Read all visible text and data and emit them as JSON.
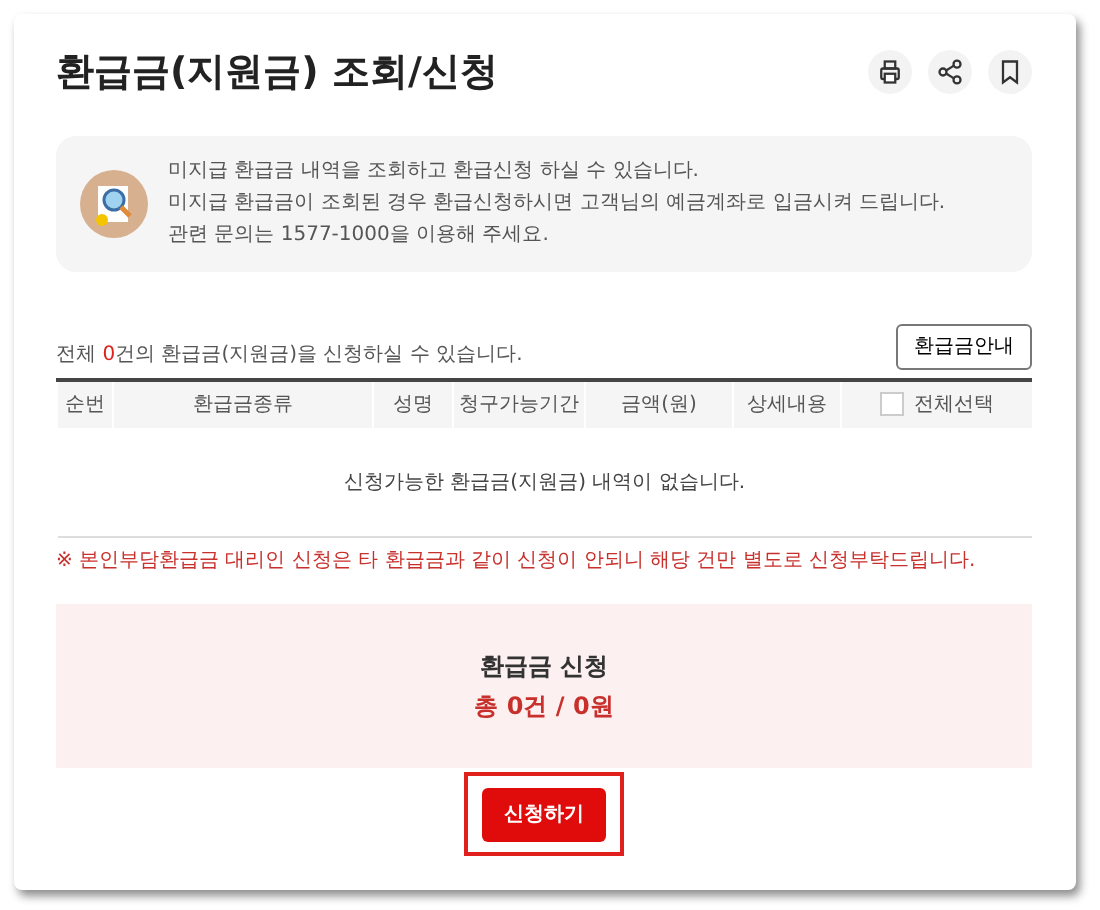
{
  "title": "환급금(지원금) 조회/신청",
  "toolbar": [
    {
      "kind": "print"
    },
    {
      "kind": "share"
    },
    {
      "kind": "bookmark"
    }
  ],
  "info": {
    "lines": [
      "미지급 환급금 내역을 조회하고 환급신청 하실 수 있습니다.",
      "미지급 환급금이 조회된 경우 환급신청하시면 고객님의 예금계좌로 입금시켜 드립니다.",
      "관련 문의는 1577-1000을 이용해 주세요."
    ]
  },
  "count_text": {
    "before": "전체 ",
    "count": "0",
    "after": "건의 환급금(지원금)을 신청하실 수 있습니다."
  },
  "guide_button": "환급금안내",
  "table": {
    "columns": [
      "순번",
      "환급금종류",
      "성명",
      "청구가능기간",
      "금액(원)",
      "상세내용"
    ],
    "select_all": {
      "label": "전체선택",
      "checked": false
    },
    "empty_message": "신청가능한 환급금(지원금) 내역이 없습니다."
  },
  "notice": "※ 본인부담환급금 대리인 신청은 타 환급금과 같이 신청이 안되니 해당 건만 별도로 신청부탁드립니다.",
  "summary": {
    "title": "환급금 신청",
    "total": "총 0건 / 0원"
  },
  "apply_button": {
    "label": "신청하기",
    "highlighted": true
  }
}
